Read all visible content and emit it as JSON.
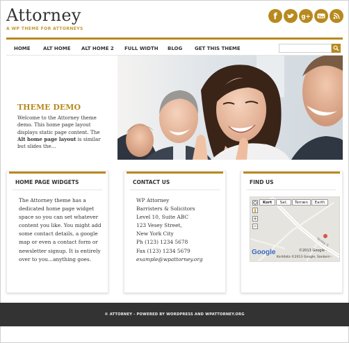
{
  "site": {
    "title": "Attorney",
    "tagline": "A WP THEME FOR ATTORNEYS"
  },
  "social": [
    {
      "label": "f",
      "icon": "facebook-icon"
    },
    {
      "label": "t",
      "icon": "twitter-icon"
    },
    {
      "label": "g+",
      "icon": "google-plus-icon"
    },
    {
      "label": "You",
      "icon": "youtube-icon"
    },
    {
      "label": "rss",
      "icon": "rss-icon"
    }
  ],
  "nav": {
    "items": [
      "HOME",
      "ALT HOME",
      "ALT HOME 2",
      "FULL WIDTH",
      "BLOG",
      "GET THIS THEME"
    ]
  },
  "hero": {
    "heading": "THEME DEMO",
    "body_1": "Welcome to the Attorney theme demo. This home page layout displays static page content. The ",
    "body_bold": "Alt home page layout",
    "body_2": " is similar but slides the..."
  },
  "widgets": {
    "home": {
      "title": "HOME PAGE WIDGETS",
      "text": "The Attorney theme has a dedicated home page widget space so you can set whatever content you like. You might add some contact details, a google map or even a contact form or newsletter signup. It is entirely over to you...anything goes."
    },
    "contact": {
      "title": "CONTACT US",
      "lines": [
        "WP Attorney",
        "Barristers & Solicitors",
        "Level 10, Suite ABC",
        "123 Vesey Street,",
        "New York City",
        "Ph (123) 1234 5678",
        "Fax (123) 1234 5679"
      ],
      "email": "example@wpattorney.org"
    },
    "find": {
      "title": "FIND US",
      "map_types": [
        "Kort",
        "Sat.",
        "Terræn",
        "Earth"
      ],
      "zoom": [
        "+",
        "−"
      ],
      "street_label": "Vesey S",
      "copyright": "©2013 Google -",
      "attribution": "Kortdata ©2013 Google, Sanborn -",
      "google_logo": "Google"
    }
  },
  "footer": {
    "text": "© ATTORNEY - POWERED BY WORDPRESS AND WPATTORNEY.ORG"
  },
  "colors": {
    "accent": "#b8891e",
    "footer_bg": "#333333"
  }
}
